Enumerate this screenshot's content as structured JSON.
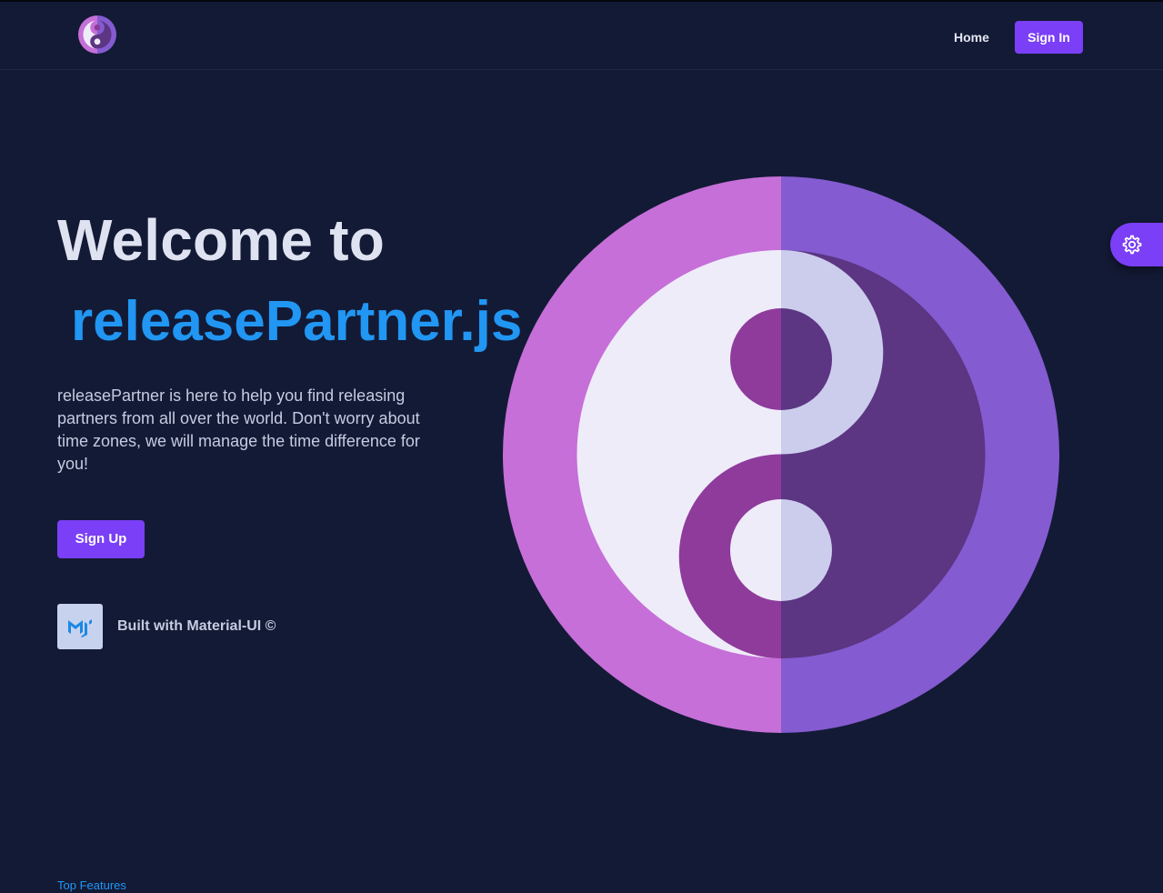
{
  "navbar": {
    "logo_icon": "yin-yang-logo-icon",
    "home_label": "Home",
    "signin_label": "Sign In"
  },
  "hero": {
    "title_line1": "Welcome to",
    "title_line2": "releasePartner.js",
    "description": "releasePartner is here to help you find releasing partners from all over the world. Don't worry about time zones, we will manage the time difference for you!",
    "signup_label": "Sign Up",
    "built_with_icon": "material-ui-icon",
    "built_with": "Built with Material-UI ©",
    "illustration_icon": "yin-yang-illustration"
  },
  "settings": {
    "icon": "gear-icon"
  },
  "footer": {
    "link_label": "Top Features"
  },
  "colors": {
    "background": "#131a35",
    "accent": "#7a3ff6",
    "title_blue": "#2196f3",
    "pink": "#c66fd8",
    "purple": "#845bd0",
    "dark_purple": "#5c3583",
    "light": "#eeecf9"
  }
}
